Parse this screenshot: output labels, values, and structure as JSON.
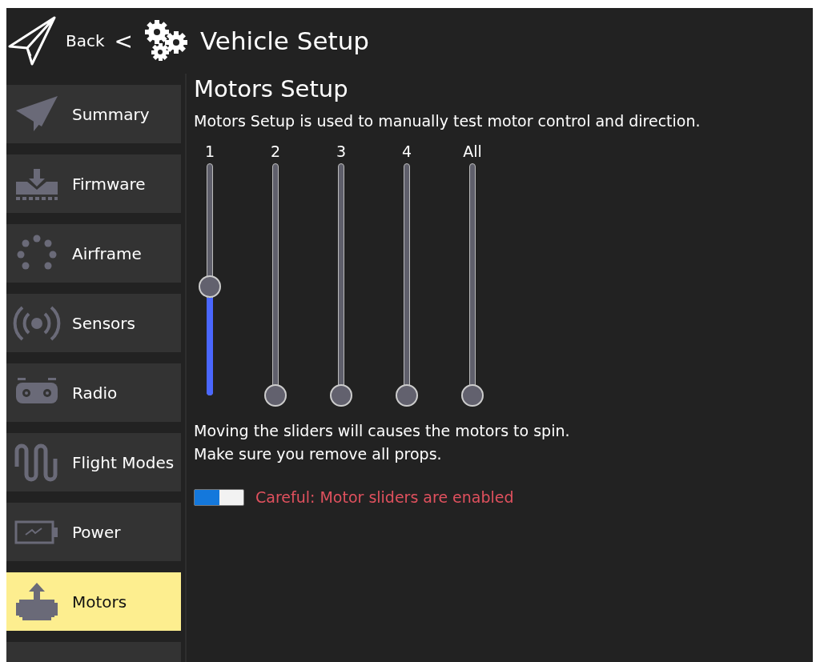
{
  "header": {
    "back_label": "Back",
    "separator": "<",
    "title": "Vehicle Setup"
  },
  "sidebar": {
    "items": [
      {
        "label": "Summary",
        "selected": false
      },
      {
        "label": "Firmware",
        "selected": false
      },
      {
        "label": "Airframe",
        "selected": false
      },
      {
        "label": "Sensors",
        "selected": false
      },
      {
        "label": "Radio",
        "selected": false
      },
      {
        "label": "Flight Modes",
        "selected": false
      },
      {
        "label": "Power",
        "selected": false
      },
      {
        "label": "Motors",
        "selected": true
      }
    ]
  },
  "content": {
    "title": "Motors Setup",
    "description": "Motors Setup is used to manually test motor control and direction.",
    "sliders": [
      {
        "label": "1",
        "level": 0.47
      },
      {
        "label": "2",
        "level": 0
      },
      {
        "label": "3",
        "level": 0
      },
      {
        "label": "4",
        "level": 0
      },
      {
        "label": "All",
        "level": 0
      }
    ],
    "warning_lines": [
      "Moving the sliders will causes the motors to spin.",
      "Make sure you remove all props."
    ],
    "enable_switch": {
      "on": true,
      "label": "Careful: Motor sliders are enabled"
    }
  }
}
